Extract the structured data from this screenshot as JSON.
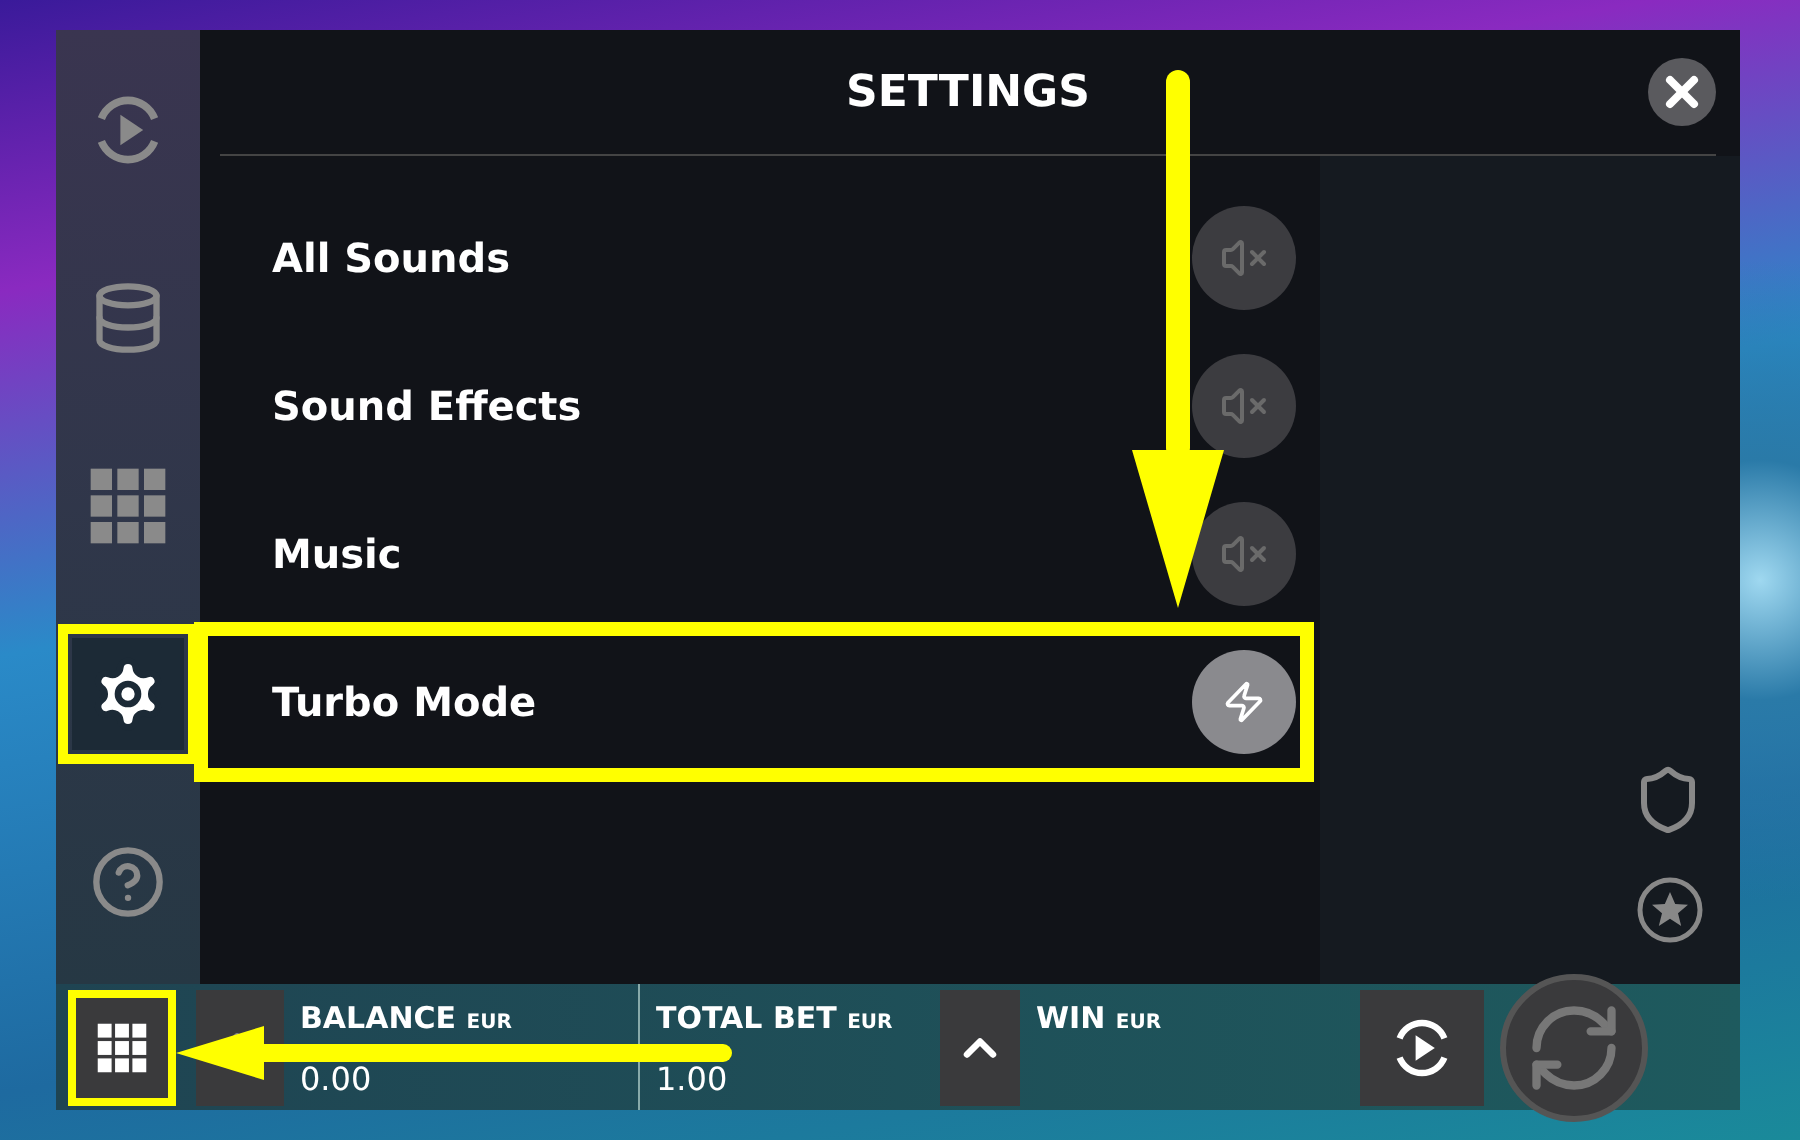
{
  "sidebar": {
    "items": [
      {
        "selected": false,
        "annotated": false
      },
      {
        "selected": false,
        "annotated": false
      },
      {
        "selected": false,
        "annotated": false
      },
      {
        "selected": true,
        "annotated": true
      },
      {
        "selected": false,
        "annotated": false
      }
    ]
  },
  "settings": {
    "title": "SETTINGS",
    "rows": [
      {
        "label": "All Sounds",
        "kind": "sound",
        "on": false,
        "annotated": false
      },
      {
        "label": "Sound Effects",
        "kind": "sound",
        "on": false,
        "annotated": false
      },
      {
        "label": "Music",
        "kind": "sound",
        "on": false,
        "annotated": false
      },
      {
        "label": "Turbo Mode",
        "kind": "turbo",
        "on": true,
        "annotated": true
      }
    ]
  },
  "bottom_bar": {
    "menu_button": {
      "annotated": true
    },
    "balance": {
      "label": "BALANCE",
      "currency": "EUR",
      "value": "0.00"
    },
    "total_bet": {
      "label": "TOTAL BET",
      "currency": "EUR",
      "value": "1.00"
    },
    "win": {
      "label": "WIN",
      "currency": "EUR"
    }
  }
}
